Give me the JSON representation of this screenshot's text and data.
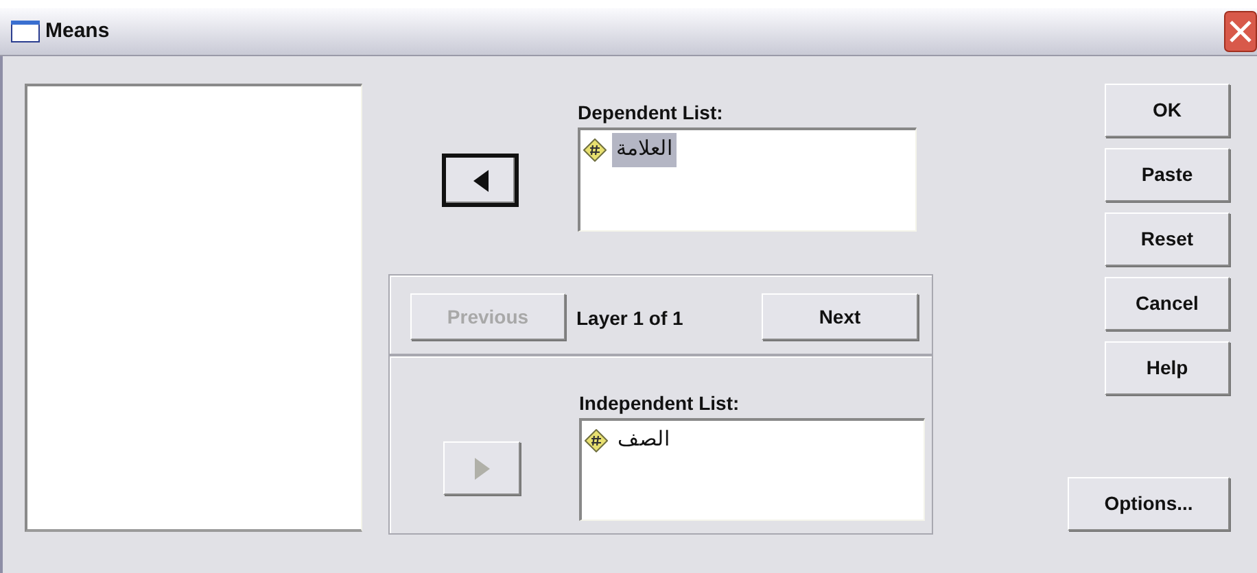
{
  "window": {
    "title": "Means"
  },
  "dependent_arrow": {
    "kind": "left",
    "disabled": false,
    "default": true
  },
  "dependent_list": {
    "label": "Dependent List:",
    "items": [
      {
        "name": "العلامة",
        "selected": true
      }
    ]
  },
  "layer": {
    "previous": {
      "label": "Previous",
      "disabled": true
    },
    "text": "Layer 1 of 1",
    "next": {
      "label": "Next",
      "disabled": false
    }
  },
  "independent_arrow": {
    "kind": "right",
    "disabled": true,
    "default": false
  },
  "independent_list": {
    "label": "Independent List:",
    "items": [
      {
        "name": "الصف",
        "selected": false
      }
    ]
  },
  "buttons": [
    {
      "label": "OK"
    },
    {
      "label": "Paste"
    },
    {
      "label": "Reset"
    },
    {
      "label": "Cancel"
    },
    {
      "label": "Help"
    }
  ],
  "options_button": {
    "label": "Options..."
  }
}
